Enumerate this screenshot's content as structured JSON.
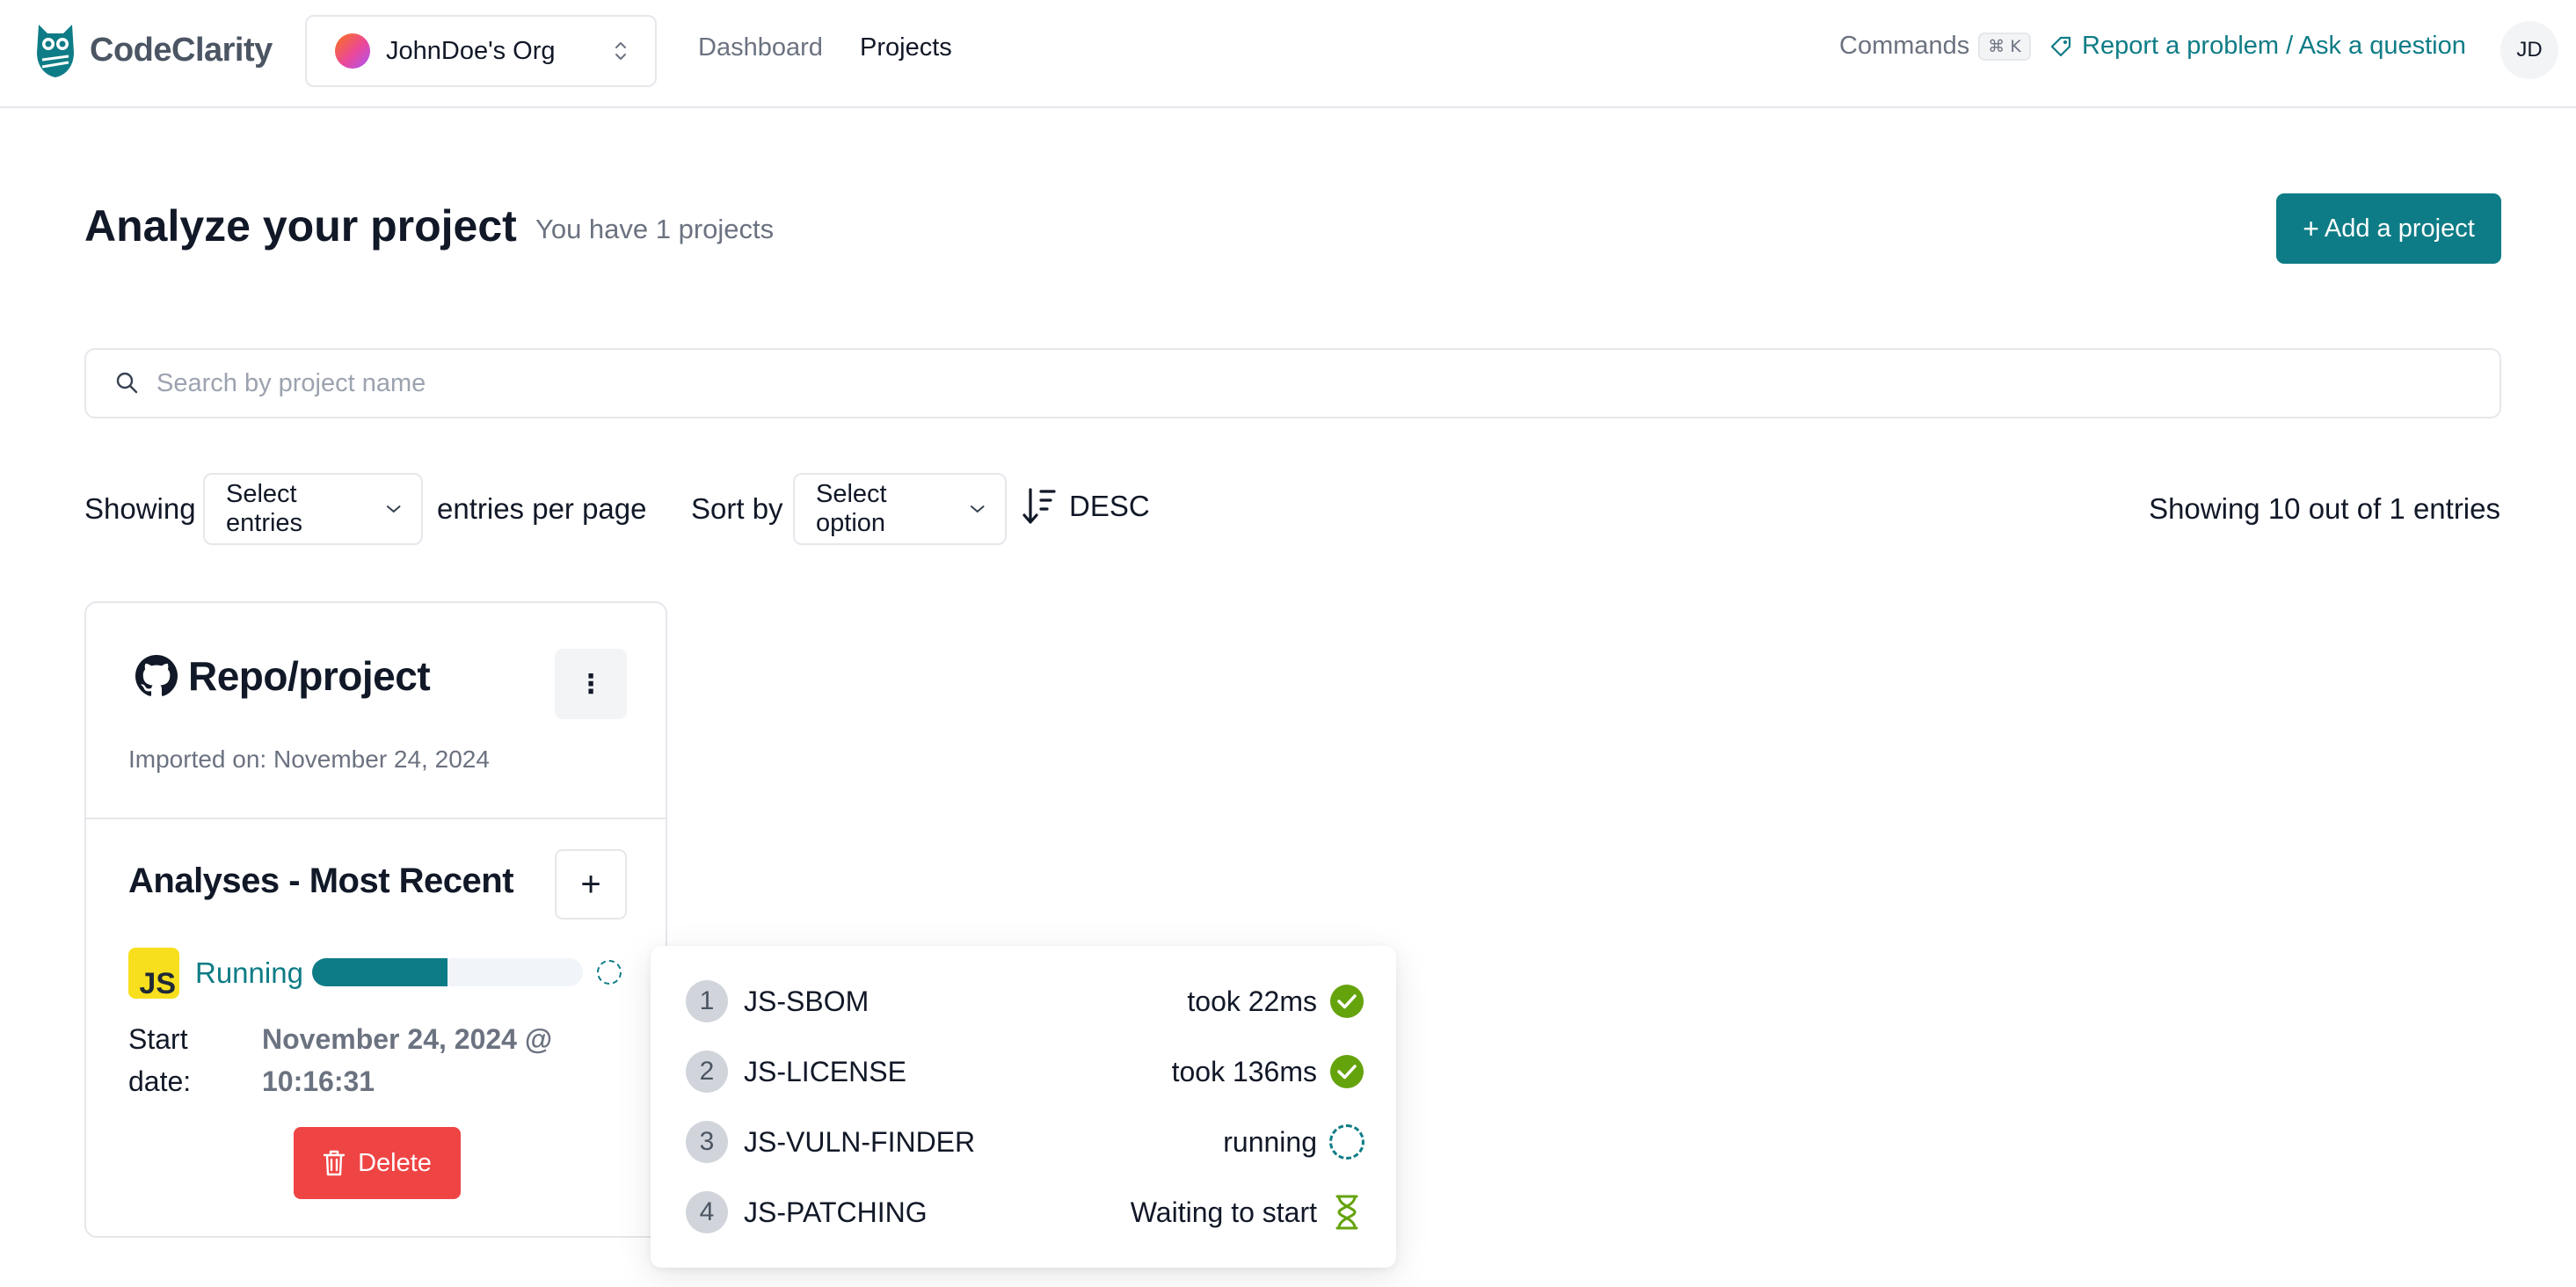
{
  "brand": {
    "name": "CodeClarity"
  },
  "org": {
    "name": "JohnDoe's Org"
  },
  "nav": {
    "dashboard": "Dashboard",
    "projects": "Projects"
  },
  "header": {
    "commands_label": "Commands",
    "commands_shortcut": "⌘ K",
    "report_label": "Report a problem / Ask a question",
    "user_initials": "JD"
  },
  "page": {
    "title": "Analyze your project",
    "project_count": "You have 1 projects",
    "add_button": "Add a project"
  },
  "search": {
    "placeholder": "Search by project name",
    "value": ""
  },
  "filters": {
    "showing_label": "Showing",
    "entries_select": "Select entries",
    "entries_suffix": "entries per page",
    "sort_label": "Sort by",
    "sort_select": "Select option",
    "sort_direction": "DESC",
    "showing_count": "Showing 10 out of 1 entries"
  },
  "project": {
    "name": "Repo/project",
    "imported": "Imported on: November 24, 2024",
    "analyses_title": "Analyses - Most Recent",
    "analysis": {
      "badge": "JS",
      "status": "Running",
      "progress": 0.5,
      "start_label": "Start date:",
      "start_date": "November 24, 2024 @ 10:16:31"
    },
    "delete_label": "Delete"
  },
  "steps": [
    {
      "num": "1",
      "name": "JS-SBOM",
      "status": "took 22ms",
      "icon": "check-circle-icon"
    },
    {
      "num": "2",
      "name": "JS-LICENSE",
      "status": "took 136ms",
      "icon": "check-circle-icon"
    },
    {
      "num": "3",
      "name": "JS-VULN-FINDER",
      "status": "running",
      "icon": "spinner-icon"
    },
    {
      "num": "4",
      "name": "JS-PATCHING",
      "status": "Waiting to start",
      "icon": "hourglass-icon"
    }
  ],
  "colors": {
    "brand": "#0e7c86",
    "danger": "#ef4444",
    "success": "#65a30d",
    "js": "#f7df1e"
  }
}
